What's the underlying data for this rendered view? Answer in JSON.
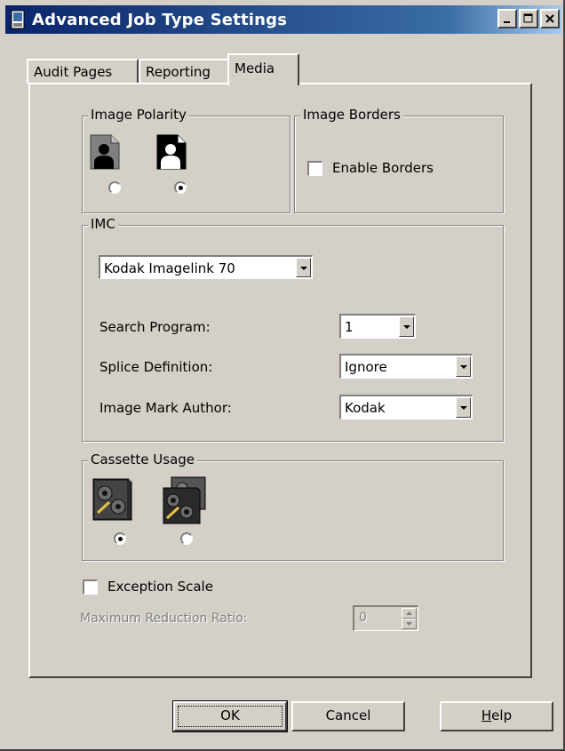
{
  "window": {
    "title": "Advanced Job Type Settings"
  },
  "tabs": [
    {
      "label": "Audit Pages"
    },
    {
      "label": "Reporting"
    },
    {
      "label": "Media"
    }
  ],
  "image_polarity": {
    "legend": "Image Polarity",
    "options": [
      {
        "icon": "negative-person-icon",
        "selected": false
      },
      {
        "icon": "positive-person-icon",
        "selected": true
      }
    ]
  },
  "image_borders": {
    "legend": "Image Borders",
    "enable_label": "Enable Borders",
    "checked": false
  },
  "imc": {
    "legend": "IMC",
    "device": "Kodak Imagelink 70",
    "search_program_label": "Search Program:",
    "search_program_value": "1",
    "splice_label": "Splice Definition:",
    "splice_value": "Ignore",
    "mark_author_label": "Image Mark Author:",
    "mark_author_value": "Kodak"
  },
  "cassette": {
    "legend": "Cassette Usage",
    "options": [
      {
        "icon": "single-cassette-icon",
        "selected": true
      },
      {
        "icon": "double-cassette-icon",
        "selected": false
      }
    ]
  },
  "exception": {
    "label": "Exception Scale",
    "checked": false,
    "max_ratio_label": "Maximum Reduction Ratio:",
    "max_ratio_value": "0"
  },
  "buttons": {
    "ok": "OK",
    "cancel": "Cancel",
    "help_prefix": "H",
    "help_rest": "elp"
  }
}
